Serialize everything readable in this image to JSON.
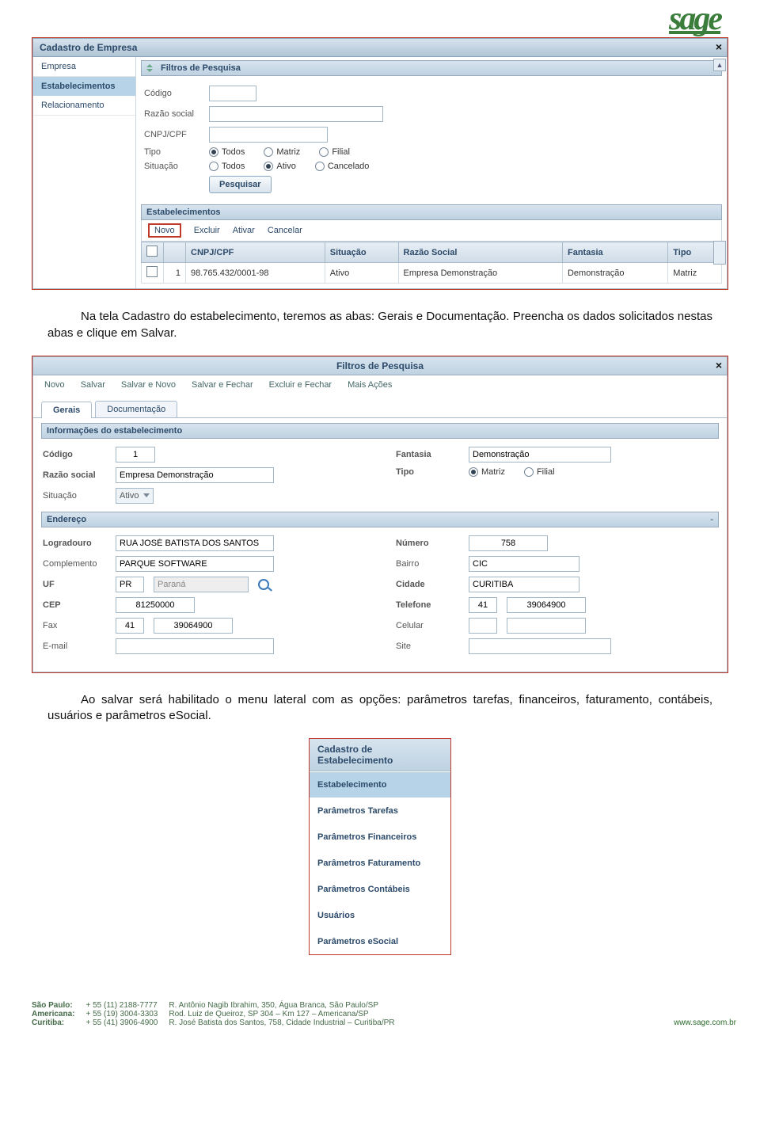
{
  "logo": "sage",
  "ss1": {
    "title": "Cadastro de Empresa",
    "sidebar": [
      "Empresa",
      "Estabelecimentos",
      "Relacionamento"
    ],
    "sidebar_active": 1,
    "section_filter": "Filtros de Pesquisa",
    "fields": {
      "codigo": "Código",
      "razao": "Razão social",
      "cnpj": "CNPJ/CPF",
      "tipo": "Tipo",
      "situacao": "Situação"
    },
    "tipo_opts": [
      "Todos",
      "Matriz",
      "Filial"
    ],
    "tipo_sel": 0,
    "sit_opts": [
      "Todos",
      "Ativo",
      "Cancelado"
    ],
    "sit_sel": 1,
    "btn_pesquisar": "Pesquisar",
    "section_list": "Estabelecimentos",
    "toolbar": [
      "Novo",
      "Excluir",
      "Ativar",
      "Cancelar"
    ],
    "cols": [
      "",
      "",
      "CNPJ/CPF",
      "Situação",
      "Razão Social",
      "Fantasia",
      "Tipo"
    ],
    "row": [
      "",
      "1",
      "98.765.432/0001-98",
      "Ativo",
      "Empresa Demonstração",
      "Demonstração",
      "Matriz"
    ]
  },
  "para1": "Na tela Cadastro do estabelecimento, teremos as abas: Gerais e Documentação. Preencha os dados solicitados nestas abas e clique em Salvar.",
  "ss2": {
    "head": "Filtros de Pesquisa",
    "toolbar": [
      "Novo",
      "Salvar",
      "Salvar e Novo",
      "Salvar e Fechar",
      "Excluir e Fechar",
      "Mais Ações"
    ],
    "tabs": [
      "Gerais",
      "Documentação"
    ],
    "section_info": "Informações do estabelecimento",
    "section_end": "Endereço",
    "left_labels": {
      "codigo": "Código",
      "razao": "Razão social",
      "situacao": "Situação",
      "log": "Logradouro",
      "compl": "Complemento",
      "uf": "UF",
      "cep": "CEP",
      "fax": "Fax",
      "email": "E-mail"
    },
    "right_labels": {
      "fantasia": "Fantasia",
      "tipo": "Tipo",
      "numero": "Número",
      "bairro": "Bairro",
      "cidade": "Cidade",
      "tel": "Telefone",
      "cel": "Celular",
      "site": "Site"
    },
    "values": {
      "codigo": "1",
      "razao": "Empresa Demonstração",
      "situacao": "Ativo",
      "log": "RUA JOSÉ BATISTA DOS SANTOS",
      "compl": "PARQUE SOFTWARE",
      "uf": "PR",
      "uf_name": "Paraná",
      "cep": "81250000",
      "fax_ddd": "41",
      "fax": "39064900",
      "fantasia": "Demonstração",
      "numero": "758",
      "bairro": "CIC",
      "cidade": "CURITIBA",
      "tel_ddd": "41",
      "tel": "39064900"
    },
    "tipo_opts": [
      "Matriz",
      "Filial"
    ],
    "tipo_sel": 0
  },
  "para2": "Ao salvar será habilitado o menu lateral com as opções: parâmetros tarefas, financeiros, faturamento, contábeis, usuários e parâmetros eSocial.",
  "ss3": {
    "title": "Cadastro de Estabelecimento",
    "items": [
      "Estabelecimento",
      "Parâmetros Tarefas",
      "Parâmetros Financeiros",
      "Parâmetros Faturamento",
      "Parâmetros Contábeis",
      "Usuários",
      "Parâmetros eSocial"
    ]
  },
  "footer": {
    "rows": [
      {
        "city": "São Paulo:",
        "phone": "+ 55 (11) 2188-7777",
        "addr": "R. Antônio Nagib Ibrahim, 350, Água Branca, São Paulo/SP"
      },
      {
        "city": "Americana:",
        "phone": "+ 55 (19) 3004-3303",
        "addr": "Rod. Luiz de Queiroz, SP 304 – Km 127 – Americana/SP"
      },
      {
        "city": "Curitiba:",
        "phone": "+ 55 (41) 3906-4900",
        "addr": "R. José Batista dos Santos, 758, Cidade Industrial – Curitiba/PR"
      }
    ],
    "site": "www.sage.com.br"
  }
}
